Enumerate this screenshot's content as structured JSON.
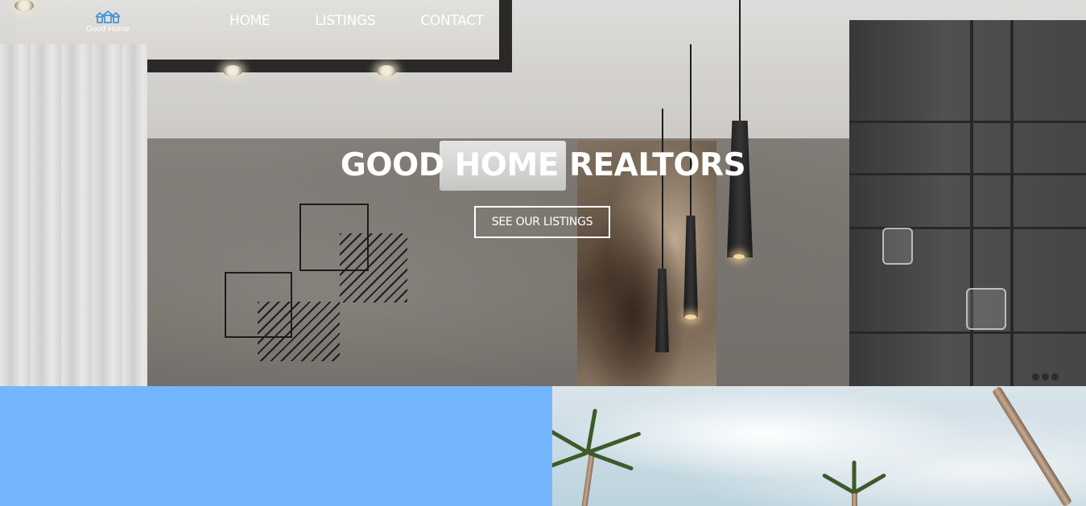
{
  "brand": {
    "name": "Good Home",
    "logo_icon": "houses-icon",
    "accent_color": "#74b6fc"
  },
  "nav": {
    "items": [
      {
        "label": "HOME"
      },
      {
        "label": "LISTINGS"
      },
      {
        "label": "CONTACT"
      }
    ]
  },
  "hero": {
    "title": "GOOD HOME REALTORS",
    "cta_label": "SEE OUR LISTINGS"
  },
  "sections": {
    "left_panel_color": "#74b6fc",
    "right_panel_image": "palm-trees-sky-photo"
  }
}
